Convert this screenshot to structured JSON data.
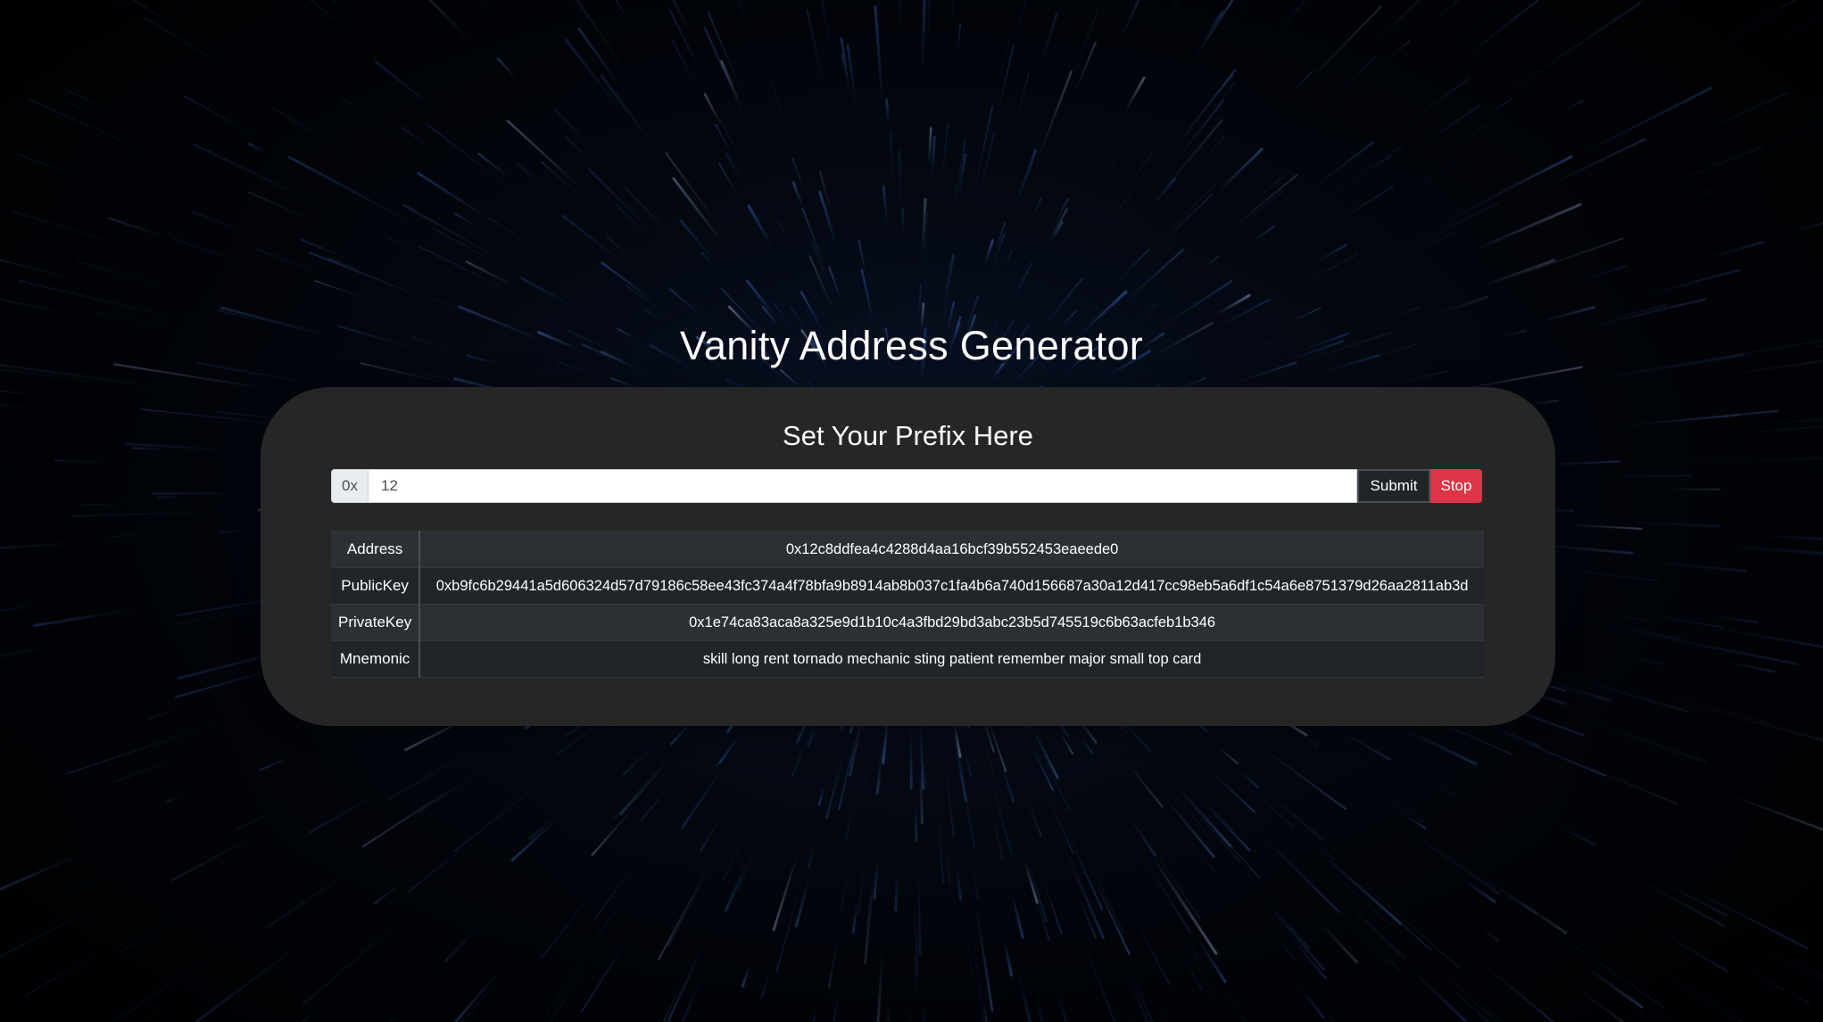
{
  "page": {
    "title": "Vanity Address Generator"
  },
  "panel": {
    "title": "Set Your Prefix Here",
    "prefix_label": "0x",
    "prefix_value": "12",
    "submit_label": "Submit",
    "stop_label": "Stop"
  },
  "results": [
    {
      "key": "Address",
      "value": "0x12c8ddfea4c4288d4aa16bcf39b552453eaeede0"
    },
    {
      "key": "PublicKey",
      "value": "0xb9fc6b29441a5d606324d57d79186c58ee43fc374a4f78bfa9b8914ab8b037c1fa4b6a740d156687a30a12d417cc98eb5a6df1c54a6e8751379d26aa2811ab3d"
    },
    {
      "key": "PrivateKey",
      "value": "0x1e74ca83aca8a325e9d1b10c4a3fbd29bd3abc23b5d745519c6b63acfeb1b346"
    },
    {
      "key": "Mnemonic",
      "value": "skill long rent tornado mechanic sting patient remember major small top card"
    }
  ],
  "colors": {
    "background": "#02050b",
    "panel": "#262626",
    "stop_button": "#dc3545",
    "submit_button": "#212529",
    "streak": "#3a6fd1"
  }
}
